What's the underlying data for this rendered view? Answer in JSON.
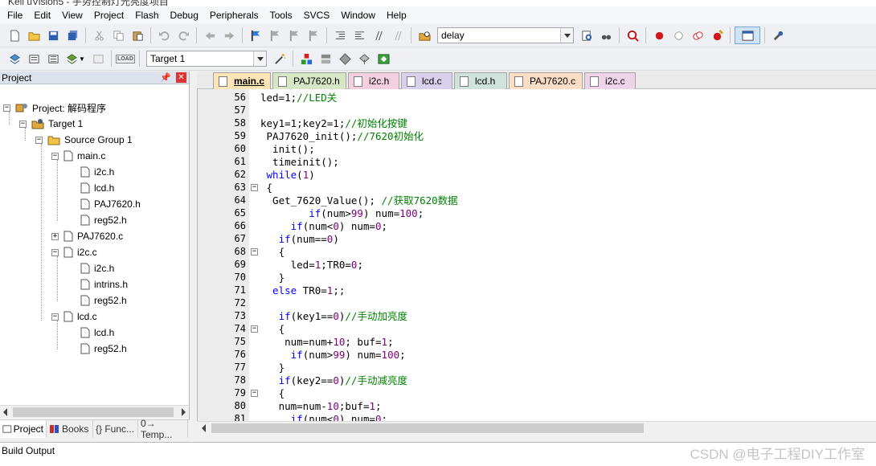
{
  "window": {
    "title": "Keil uVision5 - 手势控制灯光亮度项目"
  },
  "menu": [
    "File",
    "Edit",
    "View",
    "Project",
    "Flash",
    "Debug",
    "Peripherals",
    "Tools",
    "SVCS",
    "Window",
    "Help"
  ],
  "toolbar": {
    "find_value": "delay",
    "target_value": "Target 1",
    "load_label": "LOAD"
  },
  "project_pane": {
    "title": "Project",
    "root": "Project: 解码程序",
    "target": "Target 1",
    "group": "Source Group 1",
    "files": [
      {
        "name": "main.c",
        "expander": "−",
        "children": [
          "i2c.h",
          "lcd.h",
          "PAJ7620.h",
          "reg52.h"
        ]
      },
      {
        "name": "PAJ7620.c",
        "expander": "+",
        "children": []
      },
      {
        "name": "i2c.c",
        "expander": "−",
        "children": [
          "i2c.h",
          "intrins.h",
          "reg52.h"
        ]
      },
      {
        "name": "lcd.c",
        "expander": "−",
        "children": [
          "lcd.h",
          "reg52.h"
        ]
      }
    ],
    "tabs": [
      "Project",
      "Books",
      "{} Func...",
      "0→ Temp..."
    ]
  },
  "editor_tabs": [
    {
      "label": "main.c",
      "color": "#fbe5b6",
      "active": true
    },
    {
      "label": "PAJ7620.h",
      "color": "#d7e6c4",
      "active": false
    },
    {
      "label": "i2c.h",
      "color": "#f4cfe0",
      "active": false
    },
    {
      "label": "lcd.c",
      "color": "#d9d0ee",
      "active": false
    },
    {
      "label": "lcd.h",
      "color": "#cfe3dc",
      "active": false
    },
    {
      "label": "PAJ7620.c",
      "color": "#fbdcc4",
      "active": false
    },
    {
      "label": "i2c.c",
      "color": "#efd3e9",
      "active": false
    }
  ],
  "code": [
    {
      "n": "56",
      "fold": "",
      "segs": [
        [
          "t",
          "led=1;"
        ],
        [
          "c",
          "//LED关"
        ]
      ]
    },
    {
      "n": "57",
      "fold": "",
      "segs": []
    },
    {
      "n": "58",
      "fold": "",
      "segs": [
        [
          "t",
          "key1=1;key2=1;"
        ],
        [
          "c",
          "//初始化按键"
        ]
      ]
    },
    {
      "n": "59",
      "fold": "",
      "segs": [
        [
          "t",
          " PAJ7620_init();"
        ],
        [
          "c",
          "//7620初始化"
        ]
      ]
    },
    {
      "n": "60",
      "fold": "",
      "segs": [
        [
          "t",
          "  init();"
        ]
      ]
    },
    {
      "n": "61",
      "fold": "",
      "segs": [
        [
          "t",
          "  timeinit();"
        ]
      ]
    },
    {
      "n": "62",
      "fold": "",
      "segs": [
        [
          "k",
          " while"
        ],
        [
          "t",
          "("
        ],
        [
          "n",
          "1"
        ],
        [
          "t",
          ")"
        ]
      ]
    },
    {
      "n": "63",
      "fold": "−",
      "segs": [
        [
          "t",
          " {"
        ]
      ]
    },
    {
      "n": "64",
      "fold": "",
      "segs": [
        [
          "t",
          "  Get_7620_Value(); "
        ],
        [
          "c",
          "//获取7620数据"
        ]
      ]
    },
    {
      "n": "65",
      "fold": "",
      "segs": [
        [
          "k",
          "        if"
        ],
        [
          "t",
          "(num>"
        ],
        [
          "n",
          "99"
        ],
        [
          "t",
          ") num="
        ],
        [
          "n",
          "100"
        ],
        [
          "t",
          ";"
        ]
      ]
    },
    {
      "n": "66",
      "fold": "",
      "segs": [
        [
          "k",
          "     if"
        ],
        [
          "t",
          "(num<"
        ],
        [
          "n",
          "0"
        ],
        [
          "t",
          ") num="
        ],
        [
          "n",
          "0"
        ],
        [
          "t",
          ";"
        ]
      ]
    },
    {
      "n": "67",
      "fold": "",
      "segs": [
        [
          "k",
          "   if"
        ],
        [
          "t",
          "(num=="
        ],
        [
          "n",
          "0"
        ],
        [
          "t",
          ")"
        ]
      ]
    },
    {
      "n": "68",
      "fold": "−",
      "segs": [
        [
          "t",
          "   {"
        ]
      ]
    },
    {
      "n": "69",
      "fold": "",
      "segs": [
        [
          "t",
          "     led="
        ],
        [
          "n",
          "1"
        ],
        [
          "t",
          ";TR0="
        ],
        [
          "n",
          "0"
        ],
        [
          "t",
          ";"
        ]
      ]
    },
    {
      "n": "70",
      "fold": "",
      "segs": [
        [
          "t",
          "   }"
        ]
      ]
    },
    {
      "n": "71",
      "fold": "",
      "segs": [
        [
          "k",
          "  else"
        ],
        [
          "t",
          " TR0="
        ],
        [
          "n",
          "1"
        ],
        [
          "t",
          ";;"
        ]
      ]
    },
    {
      "n": "72",
      "fold": "",
      "segs": []
    },
    {
      "n": "73",
      "fold": "",
      "segs": [
        [
          "k",
          "   if"
        ],
        [
          "t",
          "(key1=="
        ],
        [
          "n",
          "0"
        ],
        [
          "t",
          ")"
        ],
        [
          "c",
          "//手动加亮度"
        ]
      ]
    },
    {
      "n": "74",
      "fold": "−",
      "segs": [
        [
          "t",
          "   {"
        ]
      ]
    },
    {
      "n": "75",
      "fold": "",
      "segs": [
        [
          "t",
          "    num=num+"
        ],
        [
          "n",
          "10"
        ],
        [
          "t",
          "; buf="
        ],
        [
          "n",
          "1"
        ],
        [
          "t",
          ";"
        ]
      ]
    },
    {
      "n": "76",
      "fold": "",
      "segs": [
        [
          "k",
          "     if"
        ],
        [
          "t",
          "(num>"
        ],
        [
          "n",
          "99"
        ],
        [
          "t",
          ") num="
        ],
        [
          "n",
          "100"
        ],
        [
          "t",
          ";"
        ]
      ]
    },
    {
      "n": "77",
      "fold": "",
      "segs": [
        [
          "t",
          "   }"
        ]
      ]
    },
    {
      "n": "78",
      "fold": "",
      "segs": [
        [
          "k",
          "   if"
        ],
        [
          "t",
          "(key2=="
        ],
        [
          "n",
          "0"
        ],
        [
          "t",
          ")"
        ],
        [
          "c",
          "//手动减亮度"
        ]
      ]
    },
    {
      "n": "79",
      "fold": "−",
      "segs": [
        [
          "t",
          "   {"
        ]
      ]
    },
    {
      "n": "80",
      "fold": "",
      "segs": [
        [
          "t",
          "   num=num-"
        ],
        [
          "n",
          "10"
        ],
        [
          "t",
          ";buf="
        ],
        [
          "n",
          "1"
        ],
        [
          "t",
          ";"
        ]
      ]
    },
    {
      "n": "81",
      "fold": "",
      "segs": [
        [
          "k",
          "     if"
        ],
        [
          "t",
          "(num<"
        ],
        [
          "n",
          "0"
        ],
        [
          "t",
          ") num="
        ],
        [
          "n",
          "0"
        ],
        [
          "t",
          ";"
        ]
      ]
    }
  ],
  "build_output": {
    "title": "Build Output"
  },
  "watermark": "CSDN @电子工程DIY工作室"
}
